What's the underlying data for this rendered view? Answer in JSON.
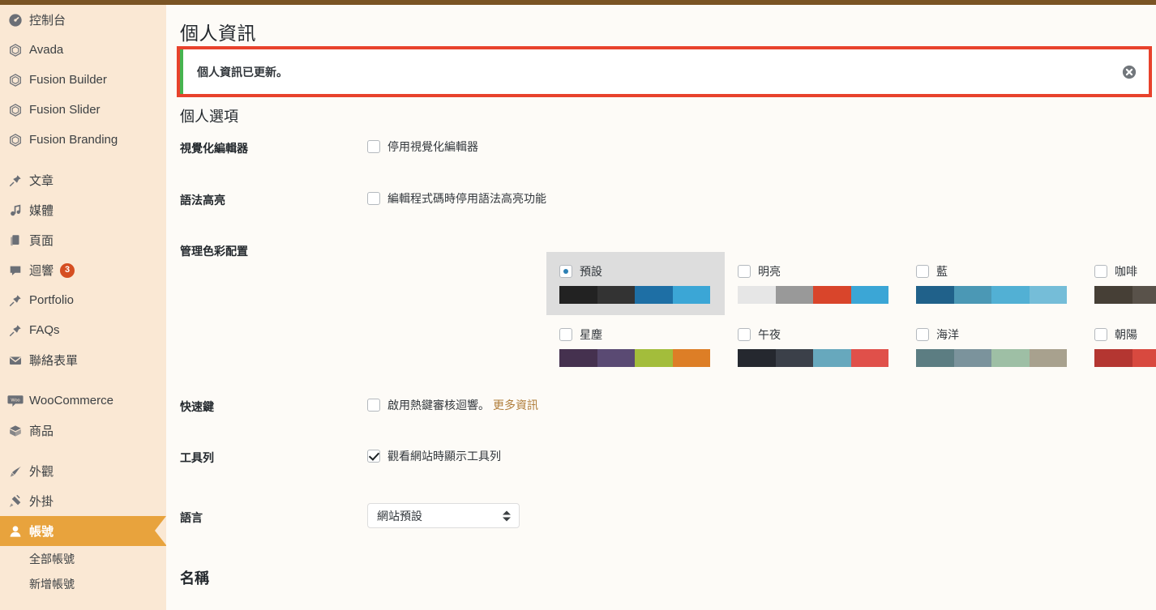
{
  "theme": {
    "adminbar_color": "#7a5424",
    "sidebar_bg": "#fae8d4",
    "active_item_bg": "#e8a33d",
    "content_bg": "#fdfbf7",
    "link_color": "#b07d3a",
    "notice_accent": "#46b450",
    "highlight_border": "#e8422c",
    "badge_color": "#d54e21"
  },
  "sidebar": {
    "items": [
      {
        "label": "控制台",
        "icon": "dashboard-icon"
      },
      {
        "label": "Avada",
        "icon": "avada-icon"
      },
      {
        "label": "Fusion Builder",
        "icon": "fusion-icon"
      },
      {
        "label": "Fusion Slider",
        "icon": "fusion-icon"
      },
      {
        "label": "Fusion Branding",
        "icon": "fusion-icon"
      },
      {
        "label": "文章",
        "icon": "pin-icon"
      },
      {
        "label": "媒體",
        "icon": "media-icon"
      },
      {
        "label": "頁面",
        "icon": "pages-icon"
      },
      {
        "label": "迴響",
        "icon": "comments-icon",
        "badge": "3"
      },
      {
        "label": "Portfolio",
        "icon": "pin-icon"
      },
      {
        "label": "FAQs",
        "icon": "pin-icon"
      },
      {
        "label": "聯絡表單",
        "icon": "envelope-icon"
      },
      {
        "label": "WooCommerce",
        "icon": "woo-icon"
      },
      {
        "label": "商品",
        "icon": "product-icon"
      },
      {
        "label": "外觀",
        "icon": "appearance-icon"
      },
      {
        "label": "外掛",
        "icon": "plugins-icon"
      },
      {
        "label": "帳號",
        "icon": "user-icon",
        "active": true
      }
    ],
    "submenu": [
      {
        "label": "全部帳號"
      },
      {
        "label": "新增帳號"
      }
    ]
  },
  "page": {
    "title": "個人資訊",
    "notice": {
      "message": "個人資訊已更新。",
      "dismiss_icon": "close-icon"
    },
    "section_title": "個人選項",
    "name_heading": "名稱"
  },
  "form": {
    "visual_editor": {
      "label": "視覺化編輯器",
      "checkbox_label": "停用視覺化編輯器",
      "checked": false
    },
    "syntax_highlight": {
      "label": "語法高亮",
      "checkbox_label": "編輯程式碼時停用語法高亮功能",
      "checked": false
    },
    "color_scheme": {
      "label": "管理色彩配置"
    },
    "shortcuts": {
      "label": "快速鍵",
      "checkbox_label": "啟用熱鍵審核迴響。",
      "more_link": "更多資訊",
      "checked": false
    },
    "toolbar": {
      "label": "工具列",
      "checkbox_label": "觀看網站時顯示工具列",
      "checked": true
    },
    "language": {
      "label": "語言",
      "value": "網站預設"
    }
  },
  "color_schemes": [
    {
      "name": "預設",
      "selected": true,
      "colors": [
        "#222222",
        "#333333",
        "#1e6fa5",
        "#3ba6d6"
      ]
    },
    {
      "name": "明亮",
      "selected": false,
      "colors": [
        "#e6e6e6",
        "#999999",
        "#d9452b",
        "#3ba6d6"
      ]
    },
    {
      "name": "藍",
      "selected": false,
      "colors": [
        "#20618a",
        "#4b98b5",
        "#52b0d4",
        "#75bdd8"
      ]
    },
    {
      "name": "咖啡",
      "selected": false,
      "colors": [
        "#463f36",
        "#59524a",
        "#cdab90",
        "#9ead80"
      ]
    },
    {
      "name": "星塵",
      "selected": false,
      "colors": [
        "#45314f",
        "#5a4a73",
        "#a3bd3b",
        "#dd7e26"
      ]
    },
    {
      "name": "午夜",
      "selected": false,
      "colors": [
        "#25282f",
        "#3b4049",
        "#67a8bd",
        "#e0504a"
      ]
    },
    {
      "name": "海洋",
      "selected": false,
      "colors": [
        "#5c7d82",
        "#7b939c",
        "#9ebfa5",
        "#a8a18e"
      ]
    },
    {
      "name": "朝陽",
      "selected": false,
      "colors": [
        "#b43631",
        "#d8493f",
        "#e08a33",
        "#cfb716"
      ]
    }
  ]
}
